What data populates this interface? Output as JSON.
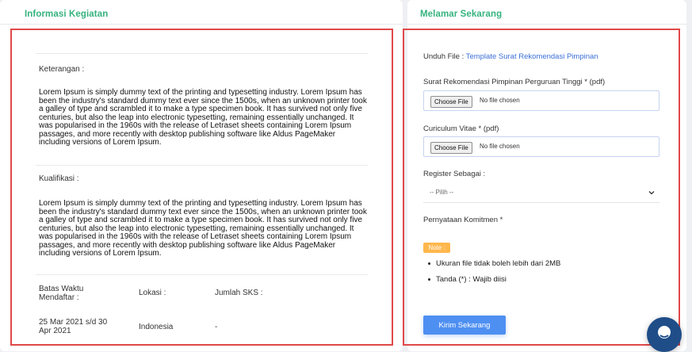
{
  "left_panel": {
    "title": "Informasi Kegiatan",
    "keterangan_label": "Keterangan :",
    "keterangan_text": "Lorem Ipsum is simply dummy text of the printing and typesetting industry. Lorem Ipsum has been the industry's standard dummy text ever since the 1500s, when an unknown printer took a galley of type and scrambled it to make a type specimen book. It has survived not only five centuries, but also the leap into electronic typesetting, remaining essentially unchanged. It was popularised in the 1960s with the release of Letraset sheets containing Lorem Ipsum passages, and more recently with desktop publishing software like Aldus PageMaker including versions of Lorem Ipsum.",
    "kualifikasi_label": "Kualifikasi :",
    "kualifikasi_text": "Lorem Ipsum is simply dummy text of the printing and typesetting industry. Lorem Ipsum has been the industry's standard dummy text ever since the 1500s, when an unknown printer took a galley of type and scrambled it to make a type specimen book. It has survived not only five centuries, but also the leap into electronic typesetting, remaining essentially unchanged. It was popularised in the 1960s with the release of Letraset sheets containing Lorem Ipsum passages, and more recently with desktop publishing software like Aldus PageMaker including versions of Lorem Ipsum.",
    "info": {
      "batas_label": "Batas Waktu Mendaftar :",
      "lokasi_label": "Lokasi :",
      "sks_label": "Jumlah SKS :",
      "batas_value": "25 Mar 2021 s/d 30 Apr 2021",
      "lokasi_value": "Indonesia",
      "sks_value": "-"
    }
  },
  "right_panel": {
    "title": "Melamar Sekarang",
    "unduh_label": "Unduh File : ",
    "unduh_link": "Template Surat Rekomendasi Pimpinan",
    "field1_label": "Surat Rekomendasi Pimpinan Perguruan Tinggi * (pdf)",
    "field2_label": "Curiculum Vitae * (pdf)",
    "choose_file_label": "Choose File",
    "no_file_text": "No file chosen",
    "register_label": "Register Sebagai :",
    "register_selected": "-- Pilih --",
    "komitmen_label": "Pernyataan Komitmen *",
    "note_badge": "Note :",
    "notes": [
      "Ukuran file tidak boleh lebih dari 2MB",
      "Tanda (*) : Wajib diisi"
    ],
    "submit_label": "Kirim Sekarang"
  },
  "icons": {
    "chat": "chat-icon",
    "chevron": "chevron-down-icon"
  },
  "colors": {
    "accent_green": "#35b37e",
    "highlight_red": "#e04848",
    "button_blue": "#4e8ff2",
    "link_blue": "#3b6fd6",
    "note_orange": "#ffb74d"
  }
}
